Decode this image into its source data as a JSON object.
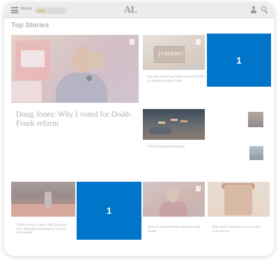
{
  "header": {
    "menu_label": "Menu",
    "weather_text": "",
    "logo": "AL",
    "logo_sub": "",
    "right_text": ""
  },
  "section": {
    "title": "Top Stories",
    "tabs": [
      "",
      "",
      ""
    ]
  },
  "lead": {
    "kicker": "",
    "headline": "Doug Jones: Why I voted for Dodd-Frank reform",
    "dek": "",
    "meta": ""
  },
  "cards": {
    "sheriff": {
      "kicker": "",
      "headline": "Etowah sheriff pocketed over $750,000 in inmate-feeding funds",
      "image_text": "|rockou|"
    },
    "uah": {
      "kicker": "",
      "headline": "UAH Highlands shooting"
    },
    "small1": {
      "kicker": "",
      "headline": ""
    },
    "small2": {
      "kicker": "",
      "headline": ""
    },
    "bama": {
      "kicker": "",
      "headline": "Collin Sexton, Donta Hall practice with Alabama basketball at NCAA tournament"
    },
    "police": {
      "kicker": "",
      "headline": "How to Survive Police Season in the South"
    },
    "icecream": {
      "kicker": "",
      "headline": "Blue Bell brings back Ice Cream Cone flavor"
    }
  },
  "overlays": {
    "box1": "1",
    "box2": "1",
    "color": "#0075c9"
  }
}
